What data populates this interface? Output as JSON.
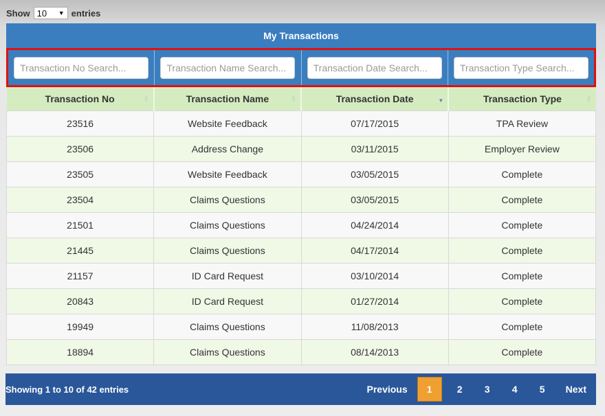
{
  "length": {
    "show_label": "Show",
    "value": "10",
    "entries_label": "entries"
  },
  "table": {
    "caption": "My Transactions",
    "search": {
      "no_placeholder": "Transaction No Search...",
      "name_placeholder": "Transaction Name Search...",
      "date_placeholder": "Transaction Date Search...",
      "type_placeholder": "Transaction Type Search..."
    },
    "columns": [
      "Transaction No",
      "Transaction Name",
      "Transaction Date",
      "Transaction Type"
    ],
    "rows": [
      [
        "23516",
        "Website Feedback",
        "07/17/2015",
        "TPA Review"
      ],
      [
        "23506",
        "Address Change",
        "03/11/2015",
        "Employer Review"
      ],
      [
        "23505",
        "Website Feedback",
        "03/05/2015",
        "Complete"
      ],
      [
        "23504",
        "Claims Questions",
        "03/05/2015",
        "Complete"
      ],
      [
        "21501",
        "Claims Questions",
        "04/24/2014",
        "Complete"
      ],
      [
        "21445",
        "Claims Questions",
        "04/17/2014",
        "Complete"
      ],
      [
        "21157",
        "ID Card Request",
        "03/10/2014",
        "Complete"
      ],
      [
        "20843",
        "ID Card Request",
        "01/27/2014",
        "Complete"
      ],
      [
        "19949",
        "Claims Questions",
        "11/08/2013",
        "Complete"
      ],
      [
        "18894",
        "Claims Questions",
        "08/14/2013",
        "Complete"
      ]
    ]
  },
  "footer": {
    "info": "Showing 1 to 10 of 42 entries",
    "previous": "Previous",
    "pages": [
      "1",
      "2",
      "3",
      "4",
      "5"
    ],
    "current_page": "1",
    "next": "Next"
  },
  "colors": {
    "header_blue": "#3a7ebf",
    "footer_blue": "#2a579a",
    "column_header_green": "#d4ecc0",
    "highlight_red": "#e01010",
    "active_page_orange": "#f0a030"
  }
}
